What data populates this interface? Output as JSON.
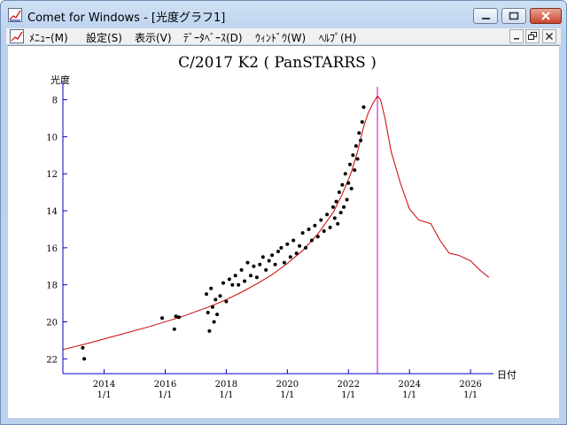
{
  "window": {
    "title": "Comet for Windows - [光度グラフ1]"
  },
  "icons": {
    "app": "chart-app-icon",
    "minimize": "minimize-icon",
    "maximize": "maximize-icon",
    "close": "close-icon",
    "mdi_minimize": "minimize-icon",
    "mdi_restore": "restore-icon",
    "mdi_close": "close-icon"
  },
  "menu": {
    "items": [
      "ﾒﾆｭｰ(M)",
      "設定(S)",
      "表示(V)",
      "ﾃﾞｰﾀﾍﾞｰｽ(D)",
      "ｳｨﾝﾄﾞｳ(W)",
      "ﾍﾙﾌﾟ(H)"
    ]
  },
  "colors": {
    "prediction_line": "#cc0000",
    "perihelion_line": "#cc00cc",
    "axis": "#0000cc",
    "points": "#000000"
  },
  "chart_data": {
    "type": "scatter",
    "title": "C/2017 K2 ( PanSTARRS )",
    "ylabel": "光度",
    "xlabel": "日付",
    "xlim": [
      2012.65,
      2026.75
    ],
    "ylim": [
      22.8,
      7.3
    ],
    "y_inverted": true,
    "y_ticks": [
      8,
      10,
      12,
      14,
      16,
      18,
      20,
      22
    ],
    "x_ticks": [
      {
        "x": 2014,
        "year": "2014",
        "day": "1/1"
      },
      {
        "x": 2016,
        "year": "2016",
        "day": "1/1"
      },
      {
        "x": 2018,
        "year": "2018",
        "day": "1/1"
      },
      {
        "x": 2020,
        "year": "2020",
        "day": "1/1"
      },
      {
        "x": 2022,
        "year": "2022",
        "day": "1/1"
      },
      {
        "x": 2024,
        "year": "2024",
        "day": "1/1"
      },
      {
        "x": 2026,
        "year": "2026",
        "day": "1/1"
      }
    ],
    "perihelion_x": 2022.95,
    "prediction": {
      "x": [
        2012.65,
        2013.5,
        2014.5,
        2015.5,
        2016.5,
        2017.5,
        2018.0,
        2018.5,
        2019.0,
        2019.5,
        2020.0,
        2020.5,
        2021.0,
        2021.5,
        2021.8,
        2022.1,
        2022.3,
        2022.5,
        2022.65,
        2022.8,
        2022.95,
        2023.05,
        2023.2,
        2023.4,
        2023.7,
        2024.0,
        2024.3,
        2024.7,
        2025.0,
        2025.3,
        2025.6,
        2026.0,
        2026.3,
        2026.6
      ],
      "y": [
        21.5,
        21.15,
        20.7,
        20.25,
        19.75,
        19.15,
        18.8,
        18.4,
        17.95,
        17.45,
        16.85,
        16.15,
        15.25,
        14.1,
        13.1,
        11.9,
        10.8,
        9.45,
        8.7,
        8.2,
        7.8,
        8.0,
        9.0,
        10.8,
        12.5,
        13.9,
        14.5,
        14.7,
        15.6,
        16.3,
        16.4,
        16.7,
        17.2,
        17.6
      ]
    },
    "observations": {
      "x": [
        2013.3,
        2013.35,
        2015.9,
        2016.3,
        2016.35,
        2016.45,
        2017.35,
        2017.4,
        2017.45,
        2017.5,
        2017.55,
        2017.6,
        2017.65,
        2017.7,
        2017.8,
        2017.9,
        2018.0,
        2018.1,
        2018.2,
        2018.3,
        2018.4,
        2018.5,
        2018.6,
        2018.7,
        2018.8,
        2018.9,
        2019.0,
        2019.1,
        2019.2,
        2019.3,
        2019.4,
        2019.5,
        2019.6,
        2019.7,
        2019.8,
        2019.9,
        2020.0,
        2020.1,
        2020.2,
        2020.3,
        2020.4,
        2020.5,
        2020.6,
        2020.7,
        2020.8,
        2020.9,
        2021.0,
        2021.1,
        2021.2,
        2021.3,
        2021.4,
        2021.5,
        2021.55,
        2021.6,
        2021.65,
        2021.7,
        2021.75,
        2021.8,
        2021.85,
        2021.9,
        2021.95,
        2022.0,
        2022.05,
        2022.1,
        2022.15,
        2022.2,
        2022.25,
        2022.3,
        2022.35,
        2022.4,
        2022.45,
        2022.5
      ],
      "y": [
        21.4,
        22.0,
        19.8,
        20.4,
        19.7,
        19.75,
        18.5,
        19.5,
        20.5,
        18.2,
        19.2,
        20.0,
        18.8,
        19.6,
        18.6,
        17.9,
        18.9,
        17.7,
        18.0,
        17.5,
        18.0,
        17.2,
        17.8,
        16.8,
        17.5,
        17.0,
        17.6,
        16.9,
        16.5,
        17.2,
        16.7,
        16.4,
        16.9,
        16.2,
        16.0,
        16.8,
        15.8,
        16.5,
        15.6,
        16.3,
        15.9,
        15.2,
        16.0,
        15.0,
        15.6,
        14.8,
        15.4,
        14.5,
        15.1,
        14.2,
        14.9,
        13.8,
        14.4,
        13.5,
        14.7,
        13.0,
        14.1,
        12.6,
        13.8,
        12.0,
        13.4,
        12.5,
        11.5,
        12.8,
        11.0,
        11.8,
        10.5,
        11.2,
        9.8,
        10.2,
        9.2,
        8.4
      ]
    }
  }
}
